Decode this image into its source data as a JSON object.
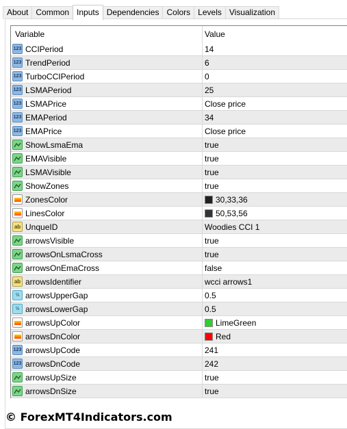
{
  "tabs": [
    "About",
    "Common",
    "Inputs",
    "Dependencies",
    "Colors",
    "Levels",
    "Visualization"
  ],
  "active_tab": "Inputs",
  "columns": {
    "variable": "Variable",
    "value": "Value"
  },
  "rows": [
    {
      "type": "int",
      "name": "CCIPeriod",
      "value": "14"
    },
    {
      "type": "int",
      "name": "TrendPeriod",
      "value": "6"
    },
    {
      "type": "int",
      "name": "TurboCCIPeriod",
      "value": "0"
    },
    {
      "type": "int",
      "name": "LSMAPeriod",
      "value": "25"
    },
    {
      "type": "int",
      "name": "LSMAPrice",
      "value": "Close price"
    },
    {
      "type": "int",
      "name": "EMAPeriod",
      "value": "34"
    },
    {
      "type": "int",
      "name": "EMAPrice",
      "value": "Close price"
    },
    {
      "type": "bool",
      "name": "ShowLsmaEma",
      "value": "true"
    },
    {
      "type": "bool",
      "name": "EMAVisible",
      "value": "true"
    },
    {
      "type": "bool",
      "name": "LSMAVisible",
      "value": "true"
    },
    {
      "type": "bool",
      "name": "ShowZones",
      "value": "true"
    },
    {
      "type": "color",
      "name": "ZonesColor",
      "value": "30,33,36",
      "swatch": "#1e2124"
    },
    {
      "type": "color",
      "name": "LinesColor",
      "value": "50,53,56",
      "swatch": "#323538"
    },
    {
      "type": "str",
      "name": "UnqueID",
      "value": "Woodies CCI 1"
    },
    {
      "type": "bool",
      "name": "arrowsVisible",
      "value": "true"
    },
    {
      "type": "bool",
      "name": "arrowsOnLsmaCross",
      "value": "true"
    },
    {
      "type": "bool",
      "name": "arrowsOnEmaCross",
      "value": "false"
    },
    {
      "type": "str",
      "name": "arrowsIdentifier",
      "value": "wcci arrows1"
    },
    {
      "type": "dbl",
      "name": "arrowsUpperGap",
      "value": "0.5"
    },
    {
      "type": "dbl",
      "name": "arrowsLowerGap",
      "value": "0.5"
    },
    {
      "type": "color",
      "name": "arrowsUpColor",
      "value": "LimeGreen",
      "swatch": "#32cd32"
    },
    {
      "type": "color",
      "name": "arrowsDnColor",
      "value": "Red",
      "swatch": "#ff0000"
    },
    {
      "type": "int",
      "name": "arrowsUpCode",
      "value": "241"
    },
    {
      "type": "int",
      "name": "arrowsDnCode",
      "value": "242"
    },
    {
      "type": "bool",
      "name": "arrowsUpSize",
      "value": "true"
    },
    {
      "type": "bool",
      "name": "arrowsDnSize",
      "value": "true"
    }
  ],
  "icons": {
    "int": "123",
    "bool": "bool-icon",
    "color": "color-icon",
    "str": "ab",
    "dbl": "½"
  },
  "watermark": "© ForexMT4Indicators.com"
}
